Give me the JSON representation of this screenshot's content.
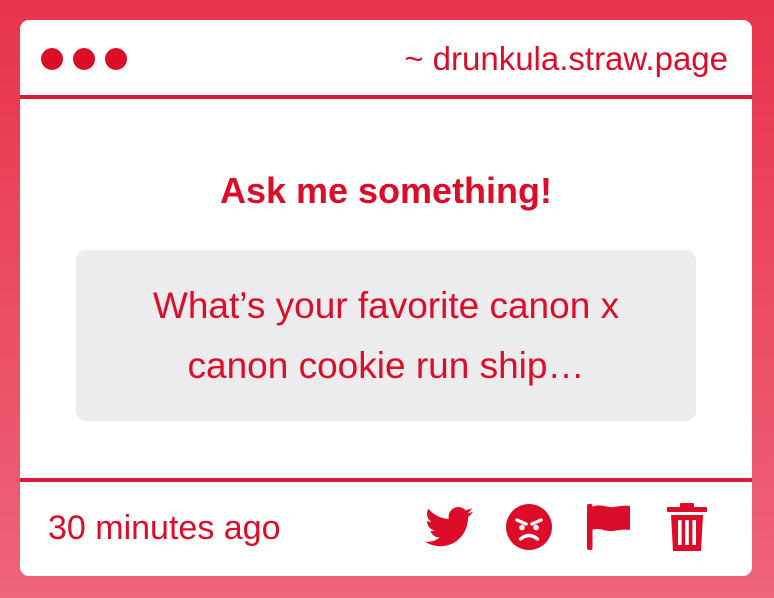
{
  "window": {
    "url": "~ drunkula.straw.page"
  },
  "prompt": {
    "heading": "Ask me something!",
    "question": "What’s your favorite canon x canon cookie run ship…"
  },
  "footer": {
    "timestamp": "30 minutes ago",
    "actions": [
      {
        "icon": "twitter-icon"
      },
      {
        "icon": "angry-face-icon"
      },
      {
        "icon": "flag-icon"
      },
      {
        "icon": "trash-icon"
      }
    ]
  },
  "colors": {
    "accent": "#dd0d2a",
    "background_top": "#e8344d",
    "background_bottom": "#ee6478",
    "question_bg": "#ecebed"
  }
}
